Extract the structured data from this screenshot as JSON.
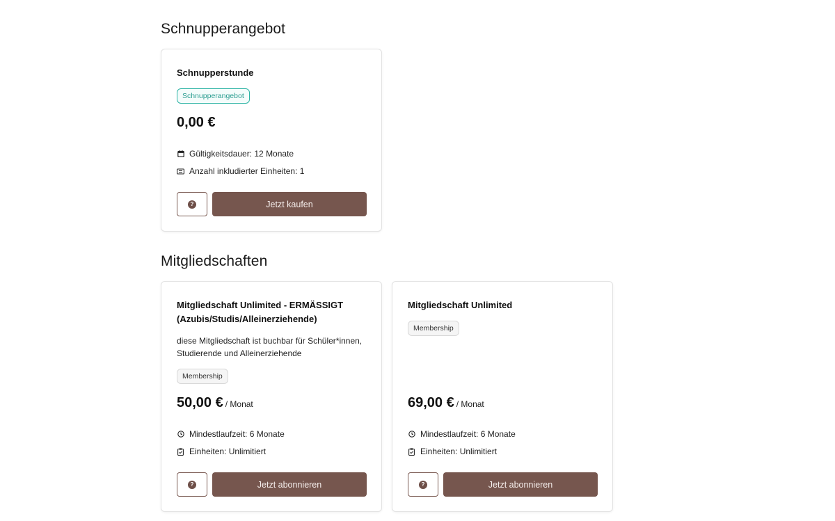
{
  "sections": {
    "trial": {
      "title": "Schnupperangebot"
    },
    "memberships": {
      "title": "Mitgliedschaften"
    }
  },
  "cards": {
    "trial": {
      "title": "Schnupperstunde",
      "badge": "Schnupperangebot",
      "price": "0,00 €",
      "info": [
        {
          "icon": "calendar-icon",
          "text": "Gültigkeitsdauer: 12 Monate"
        },
        {
          "icon": "ticket-icon",
          "text": "Anzahl inkludierter Einheiten: 1"
        }
      ],
      "help_icon": "question-icon",
      "cta": "Jetzt kaufen"
    },
    "reduced": {
      "title": "Mitgliedschaft Unlimited - ERMÄSSIGT (Azubis/Studis/Alleinerziehende)",
      "description": "diese Mitgliedschaft ist buchbar für Schüler*innen, Studierende und Alleinerziehende",
      "badge": "Membership",
      "price": "50,00 €",
      "period": "/ Monat",
      "info": [
        {
          "icon": "clock-icon",
          "text": "Mindestlaufzeit: 6 Monate"
        },
        {
          "icon": "clipboard-icon",
          "text": "Einheiten: Unlimitiert"
        }
      ],
      "help_icon": "question-icon",
      "cta": "Jetzt abonnieren"
    },
    "unlimited": {
      "title": "Mitgliedschaft Unlimited",
      "badge": "Membership",
      "price": "69,00 €",
      "period": "/ Monat",
      "info": [
        {
          "icon": "clock-icon",
          "text": "Mindestlaufzeit: 6 Monate"
        },
        {
          "icon": "clipboard-icon",
          "text": "Einheiten: Unlimitiert"
        }
      ],
      "help_icon": "question-icon",
      "cta": "Jetzt abonnieren"
    }
  },
  "colors": {
    "primary_button": "#76564e",
    "trial_badge": "#2bb3a4",
    "text": "#111111"
  }
}
